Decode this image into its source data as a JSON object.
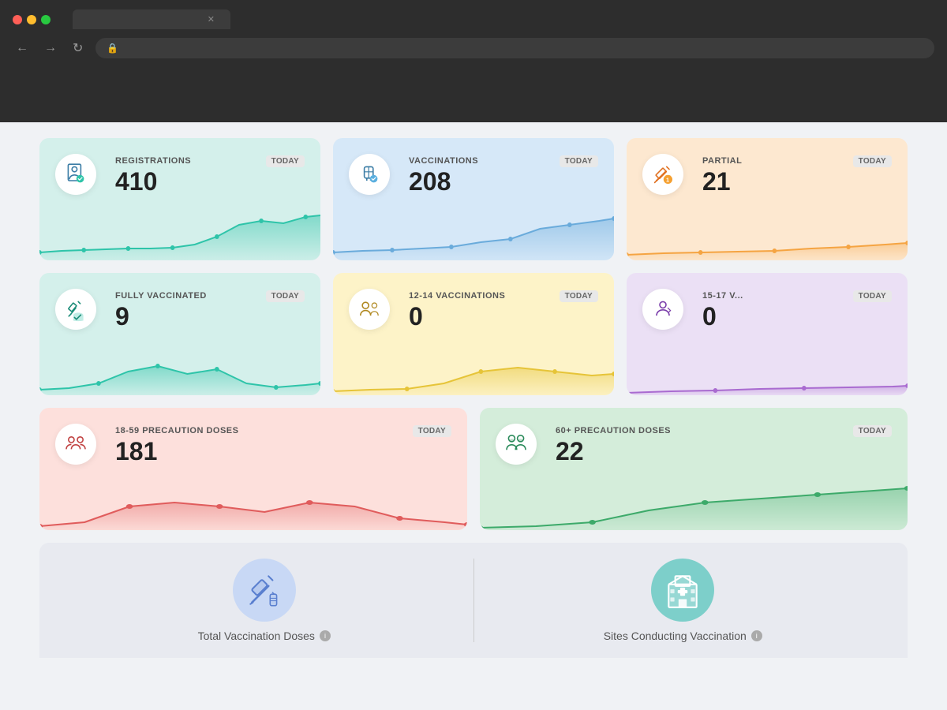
{
  "browser": {
    "tab_title": "",
    "address": ""
  },
  "cards": [
    {
      "id": "registrations",
      "label": "REGISTRATIONS",
      "badge": "TODAY",
      "value": "410",
      "color": "teal",
      "chart_color": "#2ec4a9",
      "chart_fill": "rgba(46,196,169,0.3)"
    },
    {
      "id": "vaccinations",
      "label": "VACCINATIONS",
      "badge": "TODAY",
      "value": "208",
      "color": "blue",
      "chart_color": "#6aabdb",
      "chart_fill": "rgba(106,171,219,0.3)"
    },
    {
      "id": "partial",
      "label": "PARTIAL",
      "badge": "TODAY",
      "value": "21",
      "color": "orange",
      "chart_color": "#f5a442",
      "chart_fill": "rgba(245,164,66,0.2)"
    },
    {
      "id": "fully-vaccinated",
      "label": "FULLY VACCINATED",
      "badge": "TODAY",
      "value": "9",
      "color": "green",
      "chart_color": "#2ec4a9",
      "chart_fill": "rgba(46,196,169,0.3)"
    },
    {
      "id": "12-14-vaccinations",
      "label": "12-14 VACCINATIONS",
      "badge": "TODAY",
      "value": "0",
      "color": "yellow",
      "chart_color": "#e6c438",
      "chart_fill": "rgba(230,196,56,0.3)"
    },
    {
      "id": "15-17-vaccinations",
      "label": "15-17 V...",
      "badge": "TODAY",
      "value": "0",
      "color": "purple",
      "chart_color": "#a96bd0",
      "chart_fill": "rgba(169,107,208,0.2)"
    }
  ],
  "precaution_cards": [
    {
      "id": "18-59-precaution",
      "label": "18-59 PRECAUTION DOSES",
      "badge": "TODAY",
      "value": "181",
      "color": "salmon",
      "chart_color": "#e05c5c",
      "chart_fill": "rgba(224,92,92,0.25)"
    },
    {
      "id": "60-plus-precaution",
      "label": "60+ PRECAUTION DOSES",
      "badge": "TODAY",
      "value": "22",
      "color": "mint",
      "chart_color": "#3daa6a",
      "chart_fill": "rgba(61,170,106,0.25)"
    }
  ],
  "bottom": {
    "total_label": "Total Vaccination Doses",
    "sites_label": "Sites Conducting Vaccination"
  }
}
